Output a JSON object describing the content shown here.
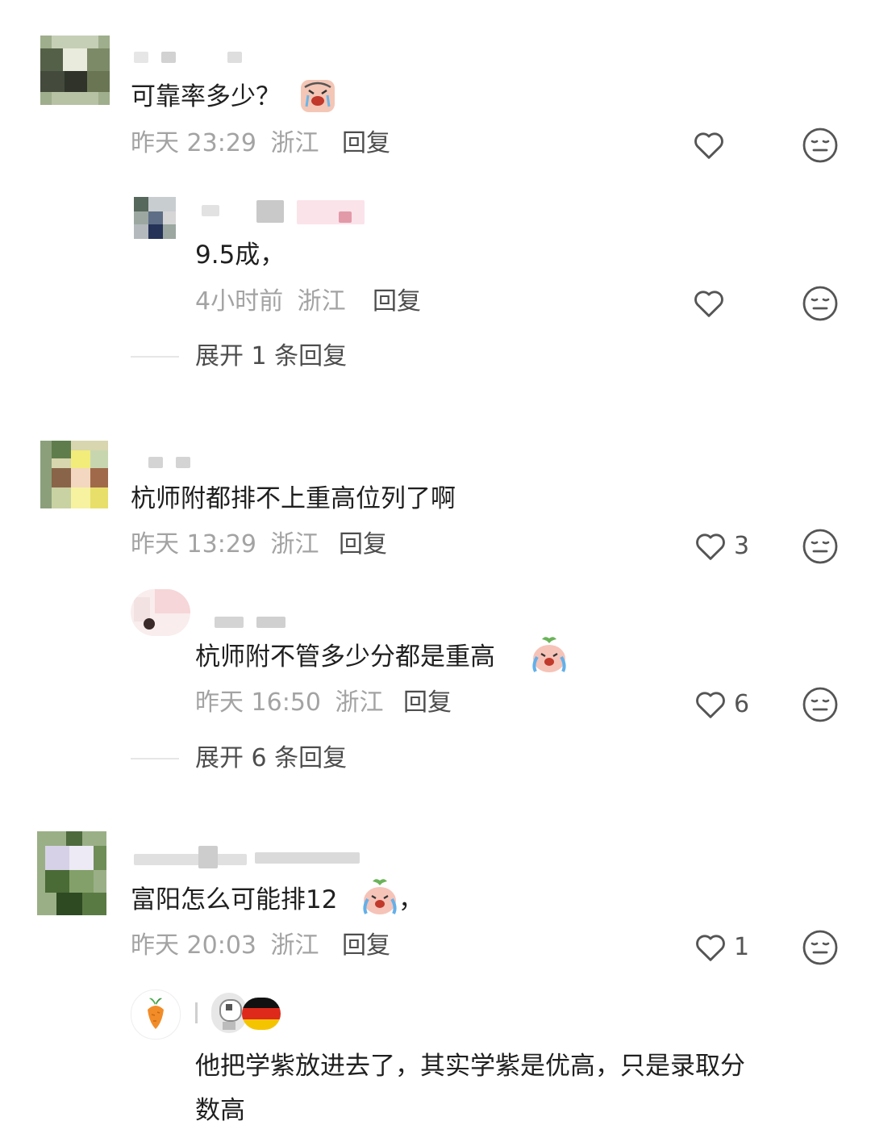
{
  "comments": [
    {
      "text": "可靠率多少？",
      "time": "昨天 23:29",
      "location": "浙江",
      "reply_label": "回复",
      "likes": "",
      "replies": [
        {
          "text": "9.5成，",
          "time": "4小时前",
          "location": "浙江",
          "reply_label": "回复",
          "likes": ""
        }
      ],
      "expand_label": "展开 1 条回复"
    },
    {
      "text": "杭师附都排不上重高位列了啊",
      "time": "昨天 13:29",
      "location": "浙江",
      "reply_label": "回复",
      "likes": "3",
      "replies": [
        {
          "text": "杭师附不管多少分都是重高",
          "time": "昨天 16:50",
          "location": "浙江",
          "reply_label": "回复",
          "likes": "6"
        }
      ],
      "expand_label": "展开 6 条回复"
    },
    {
      "text": "富阳怎么可能排12",
      "text_tail": "，",
      "time": "昨天 20:03",
      "location": "浙江",
      "reply_label": "回复",
      "likes": "1",
      "replies": [
        {
          "text_line1": "他把学紫放进去了，其实学紫是优高，只是录取分",
          "text_line2": "数高"
        }
      ]
    }
  ],
  "icons": {
    "like": "heart-outline-icon",
    "dislike": "neutral-face-icon"
  },
  "colors": {
    "text": "#1f1f1f",
    "meta": "#a3a3a3",
    "icon": "#555555"
  }
}
